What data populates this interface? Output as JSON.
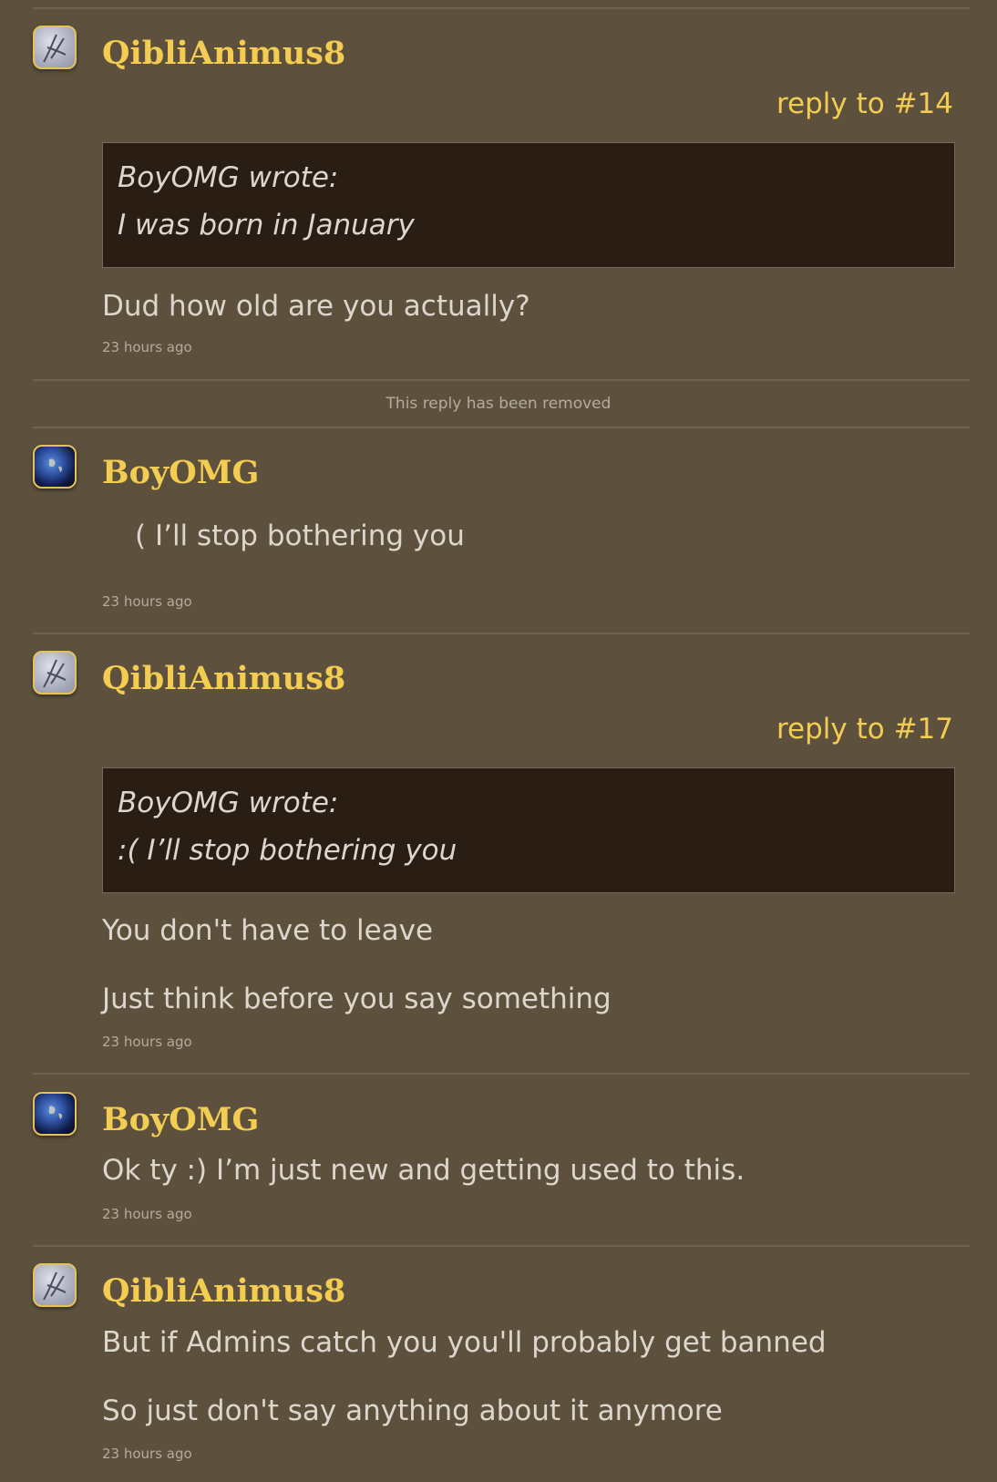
{
  "posts": [
    {
      "username": "QibliAnimus8",
      "avatar_icon": "sketch-avatar-icon",
      "reply_to": "reply to #14",
      "quote": {
        "author_line": "BoyOMG wrote:",
        "text": "I was born in January"
      },
      "lines": [
        "Dud how old are you actually?"
      ],
      "timestamp": "23 hours ago"
    },
    {
      "removed_text": "This reply has been removed"
    },
    {
      "username": "BoyOMG",
      "avatar_icon": "earth-avatar-icon",
      "lines": [
        "( I’ll stop bothering you"
      ],
      "timestamp": "23 hours ago"
    },
    {
      "username": "QibliAnimus8",
      "avatar_icon": "sketch-avatar-icon",
      "reply_to": "reply to #17",
      "quote": {
        "author_line": "BoyOMG wrote:",
        "text": ":( I’ll stop bothering you"
      },
      "lines": [
        "You don't have to leave",
        "Just think before you say something"
      ],
      "timestamp": "23 hours ago"
    },
    {
      "username": "BoyOMG",
      "avatar_icon": "earth-avatar-icon",
      "lines": [
        "Ok ty :) I’m just new and getting used to this."
      ],
      "timestamp": "23 hours ago"
    },
    {
      "username": "QibliAnimus8",
      "avatar_icon": "sketch-avatar-icon",
      "lines": [
        "But if Admins catch you you'll probably get banned",
        "So just don't say anything about it anymore"
      ],
      "timestamp": "23 hours ago"
    }
  ],
  "colors": {
    "background": "#5d513e",
    "username": "#f3cc52",
    "quote_background": "#2a1e14",
    "body_text": "#ddd6cc",
    "meta_text": "#b4ab9e"
  }
}
